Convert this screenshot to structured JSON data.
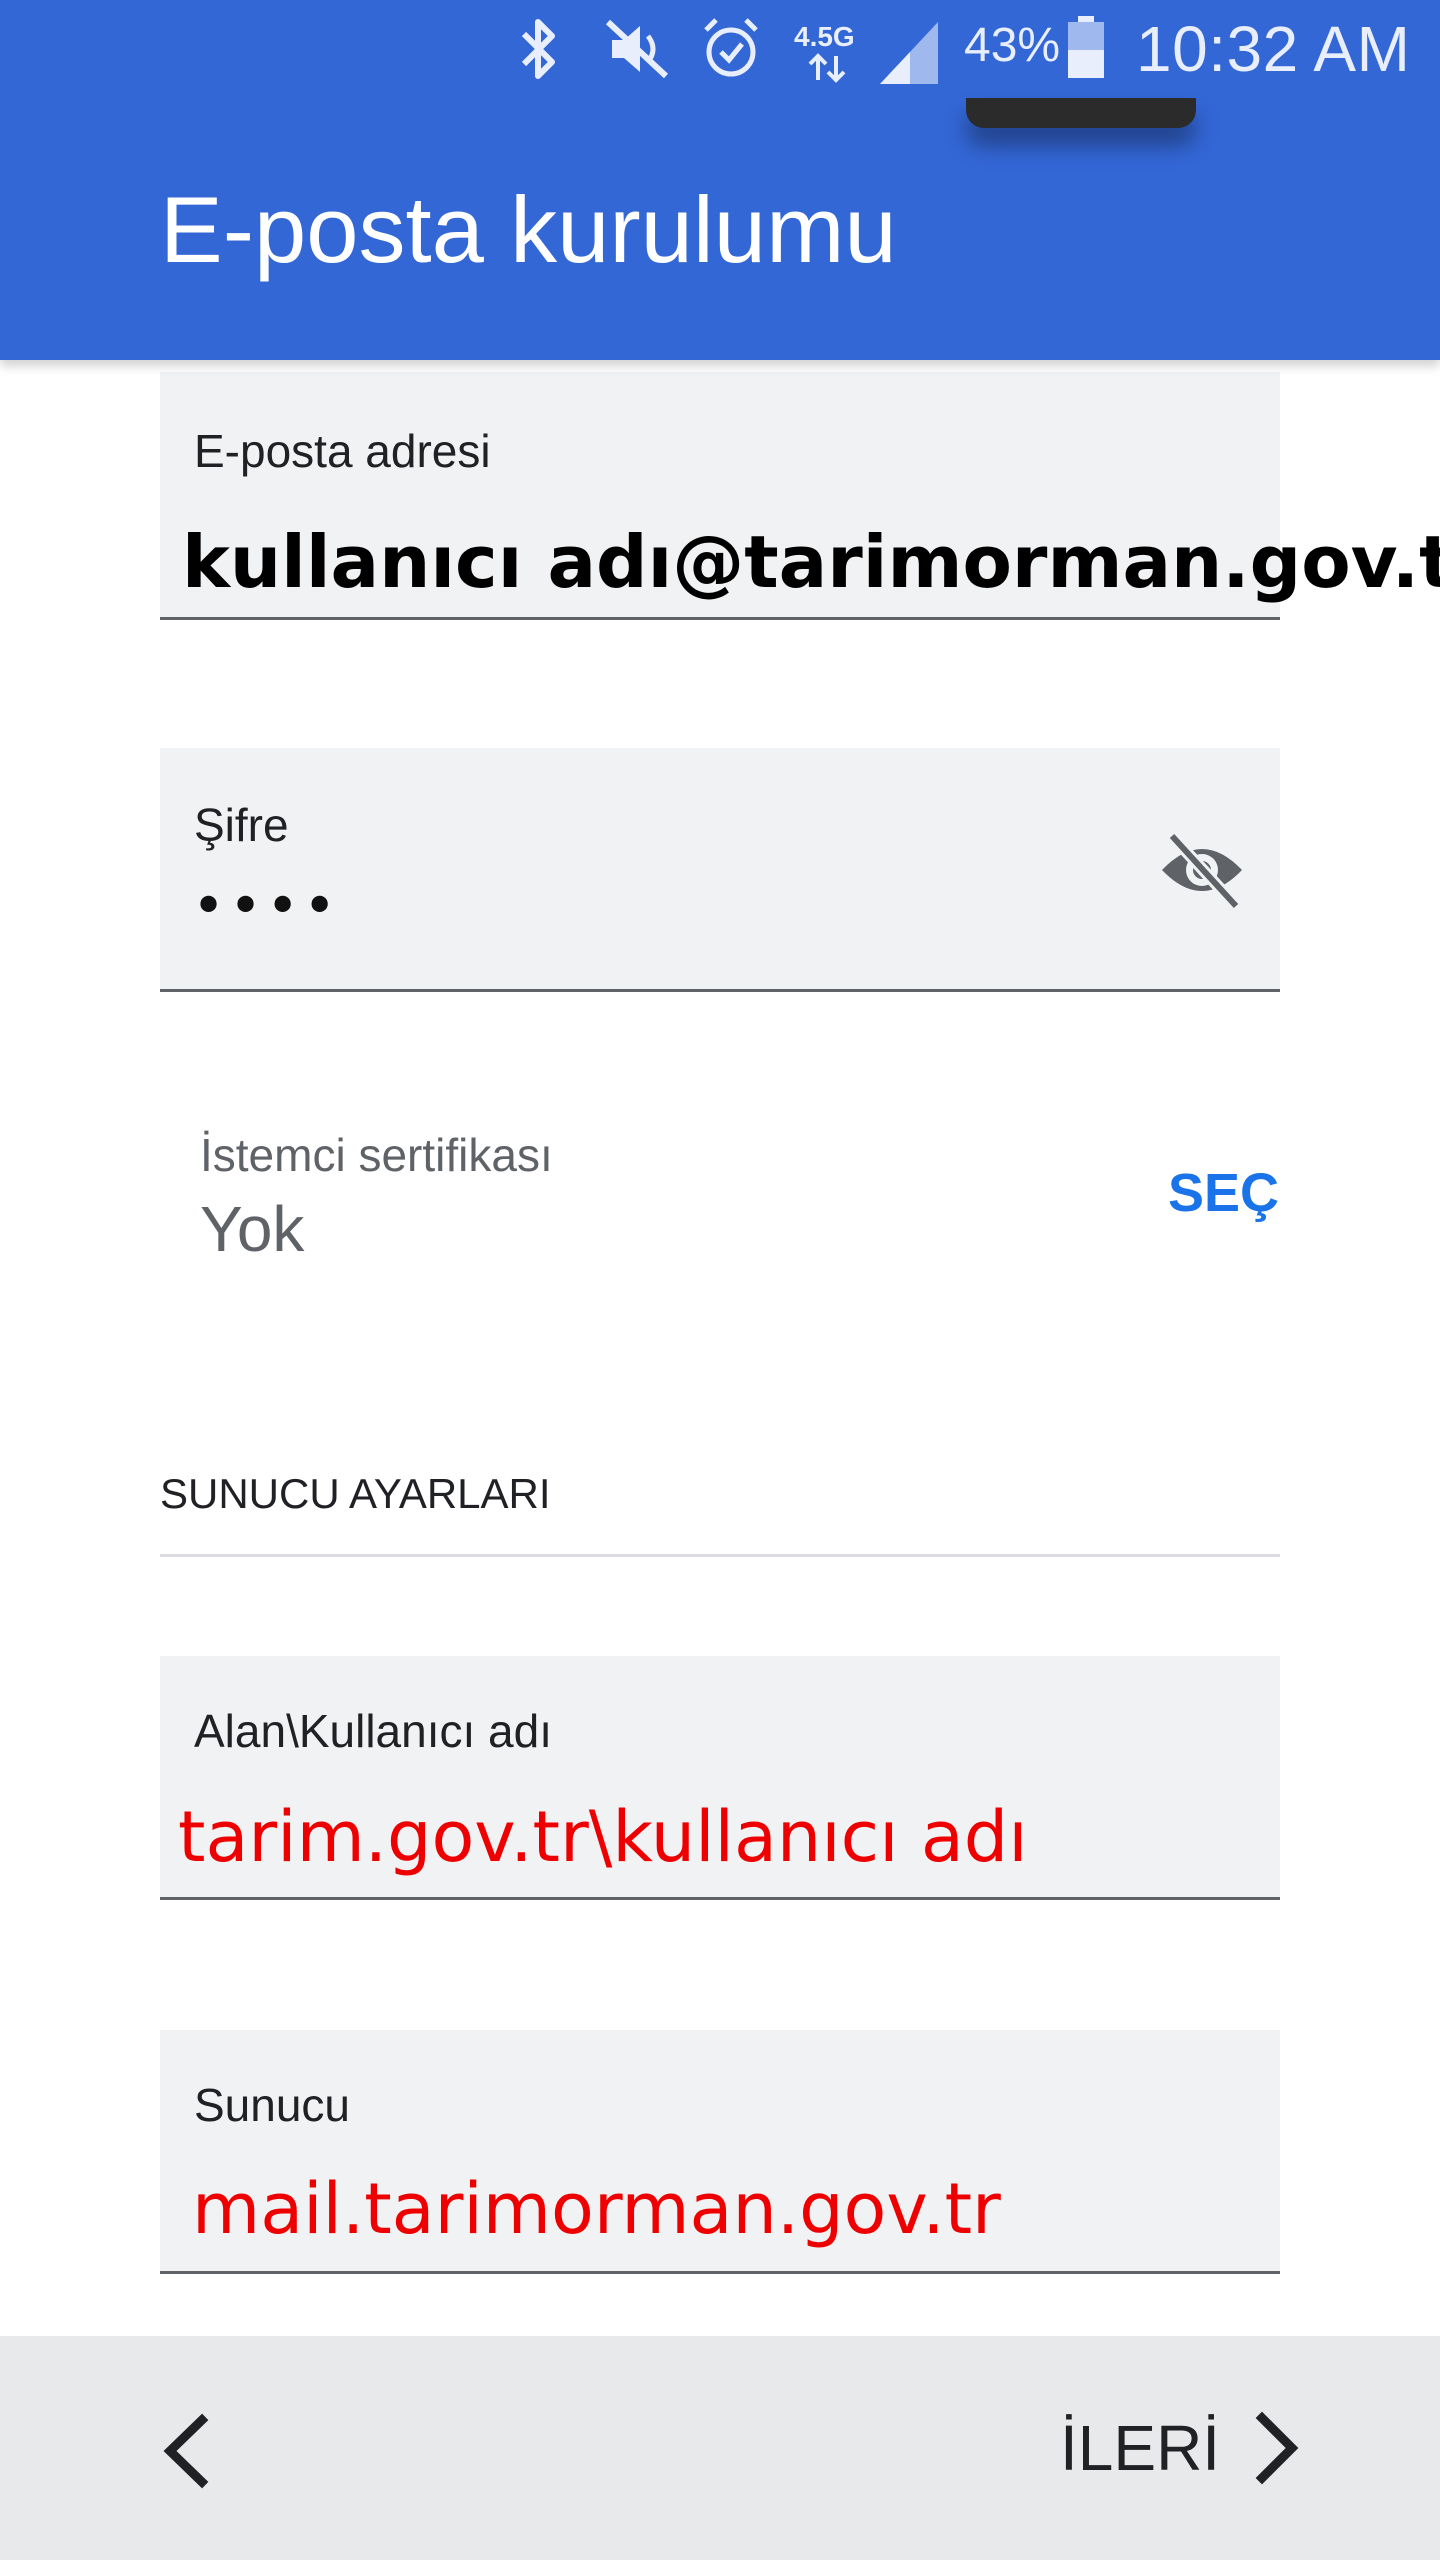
{
  "status_bar": {
    "icons": [
      "bluetooth-icon",
      "mute-icon",
      "alarm-icon",
      "4g-network-icon",
      "signal-icon",
      "battery-icon"
    ],
    "network_type": "4.5G",
    "battery_percent": "43%",
    "time": "10:32 AM"
  },
  "header": {
    "title": "E-posta kurulumu",
    "background_color": "#3367d6"
  },
  "form": {
    "email": {
      "label": "E-posta adresi",
      "value": "kullanıcı adı@tarimorman.gov.tr"
    },
    "password": {
      "label": "Şifre",
      "value": "••••",
      "toggle_icon": "visibility-off-icon"
    },
    "client_certificate": {
      "label": "İstemci sertifikası",
      "value": "Yok",
      "button_label": "SEÇ"
    },
    "server_settings": {
      "section_title": "SUNUCU AYARLARI",
      "domain_user": {
        "label": "Alan\\Kullanıcı adı",
        "value": "tarim.gov.tr\\kullanıcı adı"
      },
      "server": {
        "label": "Sunucu",
        "value": "mail.tarimorman.gov.tr"
      }
    }
  },
  "navigation": {
    "back_icon": "chevron-left-icon",
    "next_label": "İLERİ",
    "next_icon": "chevron-right-icon"
  },
  "colors": {
    "accent": "#1a73e8",
    "annotation_red": "#ee0000",
    "field_background": "#f1f2f4"
  }
}
